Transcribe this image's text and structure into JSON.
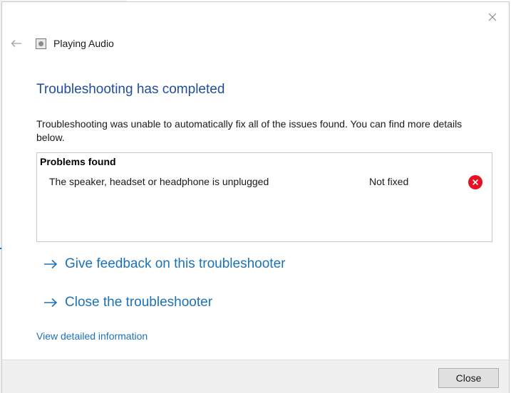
{
  "window": {
    "title": "Playing Audio",
    "icons": {
      "back": "back-arrow-icon",
      "close": "close-icon",
      "app": "audio-troubleshooter-icon"
    }
  },
  "main": {
    "heading": "Troubleshooting has completed",
    "description": "Troubleshooting was unable to automatically fix all of the issues found. You can find more details below."
  },
  "problems": {
    "header": "Problems found",
    "items": [
      {
        "name": "The speaker, headset or headphone is unplugged",
        "status": "Not fixed",
        "status_icon": "error-icon"
      }
    ]
  },
  "links": {
    "feedback": "Give feedback on this troubleshooter",
    "close_troubleshooter": "Close the troubleshooter",
    "detailed_info": "View detailed information"
  },
  "footer": {
    "close_label": "Close"
  },
  "colors": {
    "heading": "#1f4e9c",
    "link": "#1c72b8",
    "error": "#e81123",
    "footer_bg": "#f0f0f0",
    "button_bg": "#e1e1e1"
  }
}
